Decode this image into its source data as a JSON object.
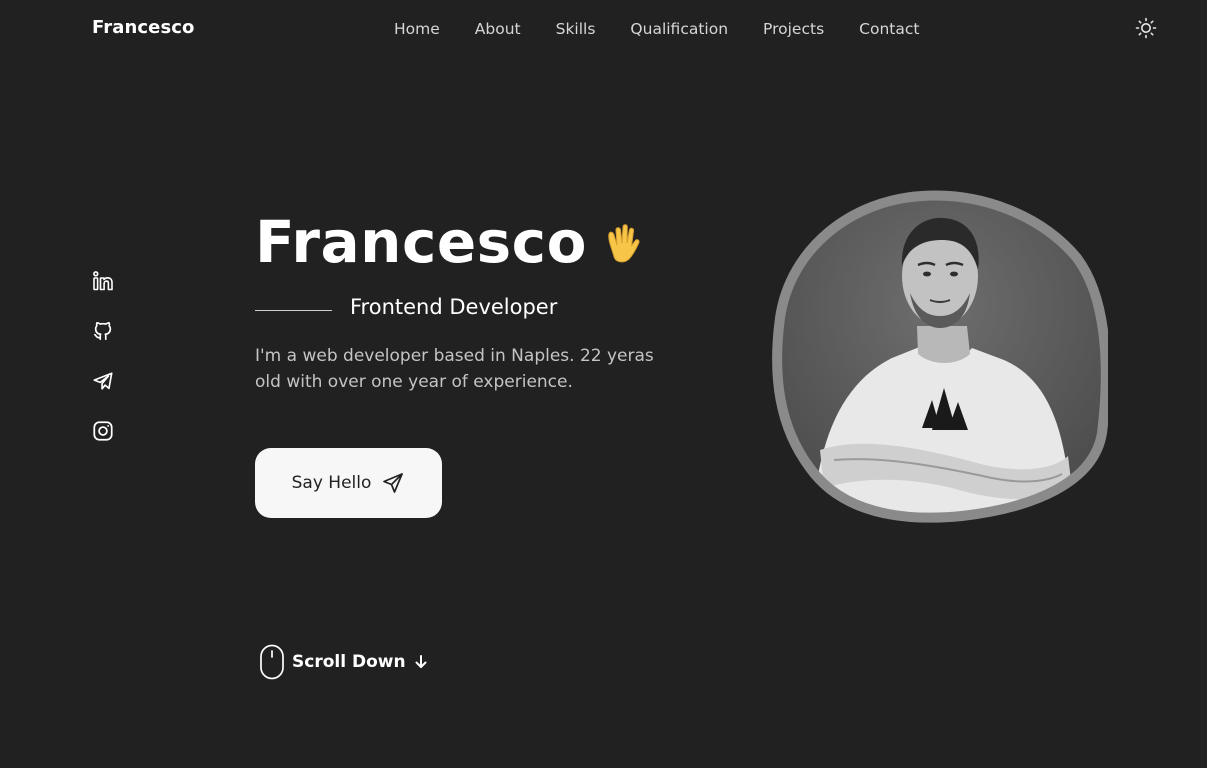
{
  "header": {
    "logo": "Francesco",
    "nav": [
      "Home",
      "About",
      "Skills",
      "Qualification",
      "Projects",
      "Contact"
    ],
    "theme_icon": "sun-icon"
  },
  "social": {
    "icons": [
      "linkedin-icon",
      "github-icon",
      "telegram-icon",
      "instagram-icon"
    ]
  },
  "hero": {
    "name": "Francesco",
    "wave_icon": "waving-hand-icon",
    "subtitle": "Frontend Developer",
    "description": "I'm a web developer based in Naples. 22 yeras old with over one year of experience.",
    "button_label": "Say Hello",
    "button_icon": "send-icon"
  },
  "scroll": {
    "label": "Scroll Down",
    "mouse_icon": "mouse-icon",
    "arrow_icon": "arrow-down-icon"
  },
  "colors": {
    "background": "#212121",
    "text": "#ffffff",
    "muted_text": "#c4c4c4",
    "button_bg": "#f7f7f7",
    "blob_border": "#8a8a8a"
  }
}
